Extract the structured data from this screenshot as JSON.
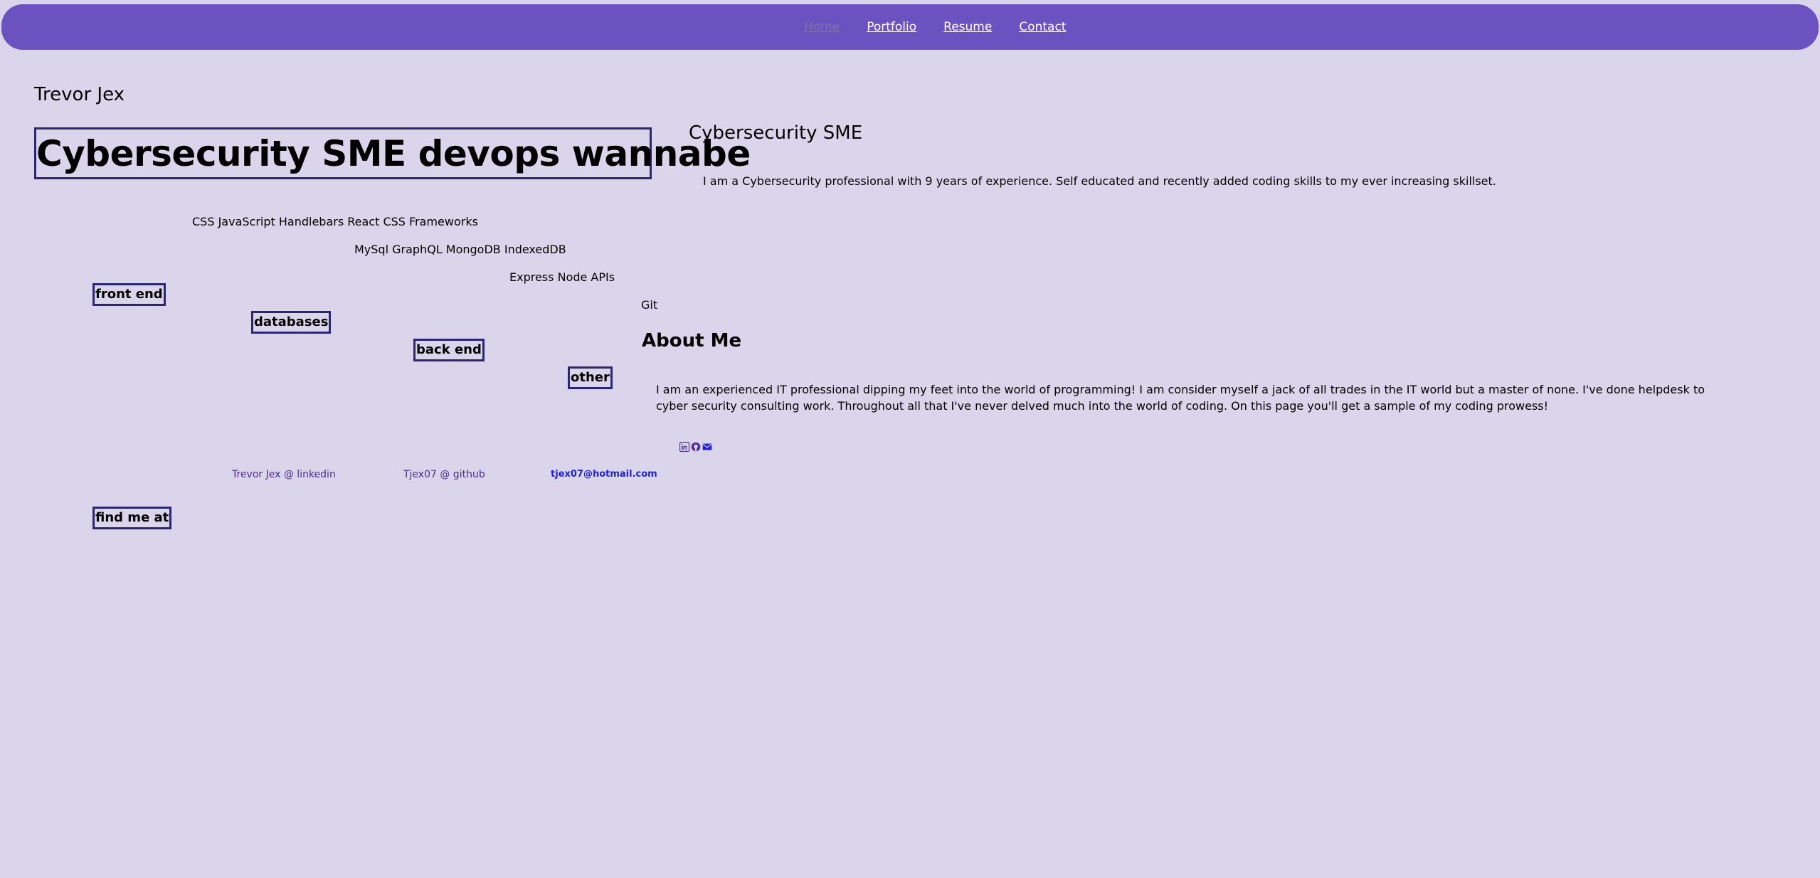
{
  "nav": {
    "items": [
      {
        "label": "Home"
      },
      {
        "label": "Portfolio"
      },
      {
        "label": "Resume"
      },
      {
        "label": "Contact"
      }
    ]
  },
  "header": {
    "site_name": "Trevor Jex",
    "tagline": "Cybersecurity SME devops wannabe"
  },
  "skills": {
    "front_end": {
      "heading": "front end",
      "items": "CSS JavaScript Handlebars React CSS Frameworks"
    },
    "databases": {
      "heading": "databases",
      "items": "MySql GraphQL MongoDB IndexedDB"
    },
    "back_end": {
      "heading": "back end",
      "items": "Express Node APIs"
    },
    "other": {
      "heading": "other",
      "items": "Git"
    }
  },
  "intro": {
    "title": "Cybersecurity SME",
    "description": "I am a Cybersecurity professional with 9 years of experience. Self educated and recently added coding skills to my ever increasing skillset."
  },
  "about": {
    "heading": "About Me",
    "body": "I am an experienced IT professional dipping my feet into the world of programming! I am consider myself a jack of all trades in the IT world but a master of none. I've done helpdesk to cyber security consulting work. Throughout all that I've never delved much into the world of coding. On this page you'll get a sample of my coding prowess!"
  },
  "social_icons": [
    {
      "icon": "linkedin-icon",
      "color": "#4e2a8e"
    },
    {
      "icon": "github-icon",
      "color": "#4e2a8e"
    },
    {
      "icon": "email-icon",
      "color": "#2020d8"
    }
  ],
  "footer": {
    "find_me_label": "find me at",
    "links": {
      "linkedin": "Trevor Jex @ linkedin",
      "github": "Tjex07 @ github",
      "email": "tjex07@hotmail.com"
    }
  },
  "colors": {
    "background": "#dbd5ec",
    "nav": "#6c51c0",
    "border": "#2b2870"
  }
}
